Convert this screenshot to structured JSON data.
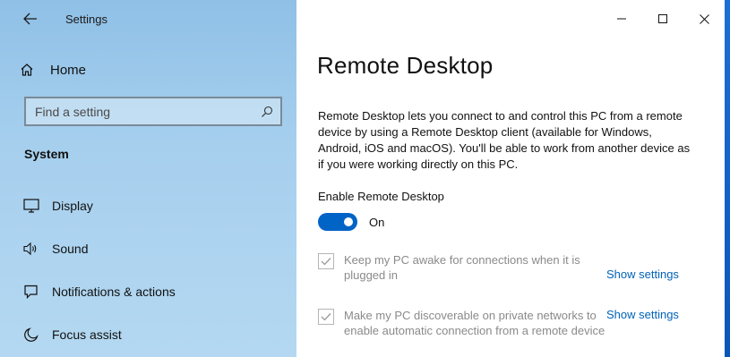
{
  "app": {
    "title": "Settings"
  },
  "sidebar": {
    "home_label": "Home",
    "search_placeholder": "Find a setting",
    "section_title": "System",
    "items": [
      {
        "label": "Display",
        "icon": "monitor-icon"
      },
      {
        "label": "Sound",
        "icon": "speaker-icon"
      },
      {
        "label": "Notifications & actions",
        "icon": "notification-icon"
      },
      {
        "label": "Focus assist",
        "icon": "moon-icon"
      }
    ]
  },
  "main": {
    "title": "Remote Desktop",
    "description": "Remote Desktop lets you connect to and control this PC from a remote device by using a Remote Desktop client (available for Windows, Android, iOS and macOS). You'll be able to work from another device as if you were working directly on this PC.",
    "enable_label": "Enable Remote Desktop",
    "toggle_state": "On",
    "options": [
      {
        "text": "Keep my PC awake for connections when it is plugged in",
        "checked": true,
        "link": "Show settings"
      },
      {
        "text": "Make my PC discoverable on private networks to enable automatic connection from a remote device",
        "checked": true,
        "link": "Show settings"
      }
    ]
  },
  "colors": {
    "accent": "#0063c6",
    "link": "#0062b8",
    "sidebar_top": "#8fc0e6",
    "sidebar_bottom": "#b4d8f1"
  }
}
